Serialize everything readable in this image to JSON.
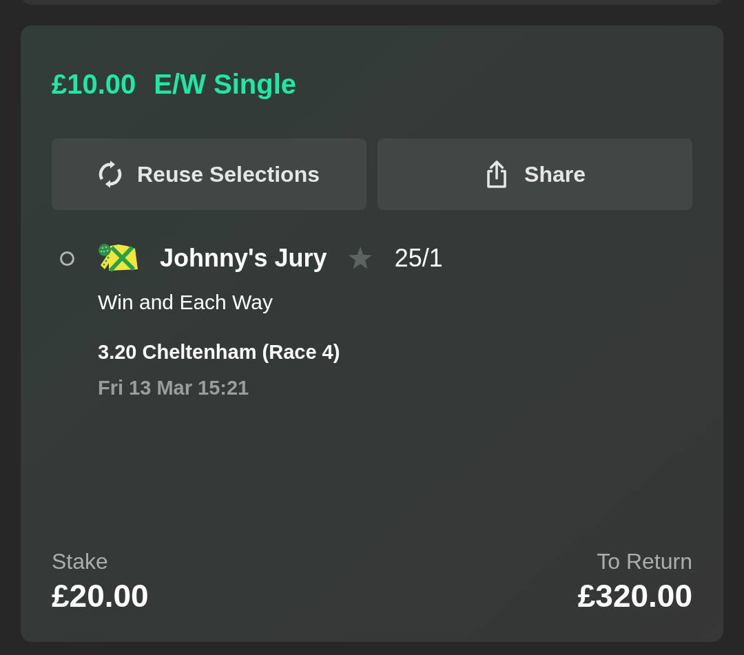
{
  "bet": {
    "stake_per_way": "£10.00",
    "bet_type": "E/W Single"
  },
  "actions": [
    {
      "kind": "reuse",
      "label": "Reuse Selections"
    },
    {
      "kind": "share",
      "label": "Share"
    }
  ],
  "selection": {
    "selected": false,
    "name": "Johnny's Jury",
    "favourite": false,
    "odds": "25/1",
    "market": "Win and Each Way",
    "race": "3.20 Cheltenham (Race 4)",
    "time": "Fri 13 Mar 15:21"
  },
  "totals": {
    "stake_label": "Stake",
    "stake": "£20.00",
    "return_label": "To Return",
    "return": "£320.00"
  }
}
